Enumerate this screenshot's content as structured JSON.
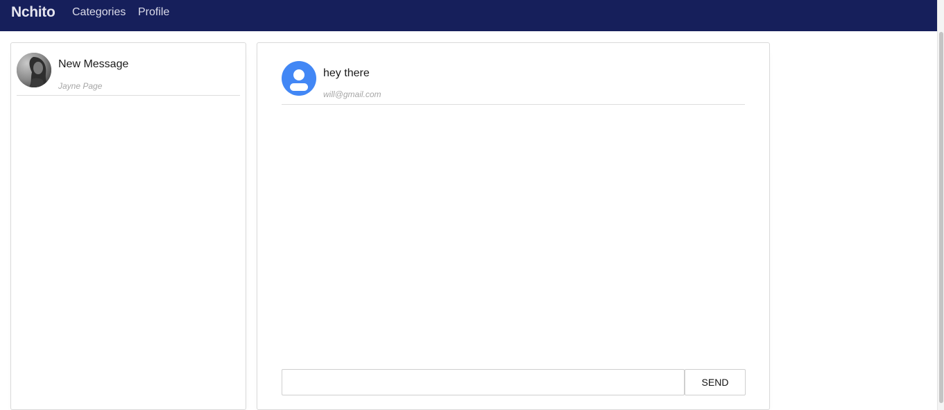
{
  "nav": {
    "brand": "Nchito",
    "links": [
      "Categories",
      "Profile"
    ],
    "background": "#161f5b"
  },
  "conversations": [
    {
      "title": "New Message",
      "subtitle": "Jayne Page",
      "avatar": "user-photo"
    }
  ],
  "messages": [
    {
      "text": "hey there",
      "sender": "will@gmail.com",
      "avatar": "default-user-icon",
      "avatar_color": "#4287f5"
    }
  ],
  "composer": {
    "input_value": "",
    "input_placeholder": "",
    "send_label": "SEND"
  }
}
